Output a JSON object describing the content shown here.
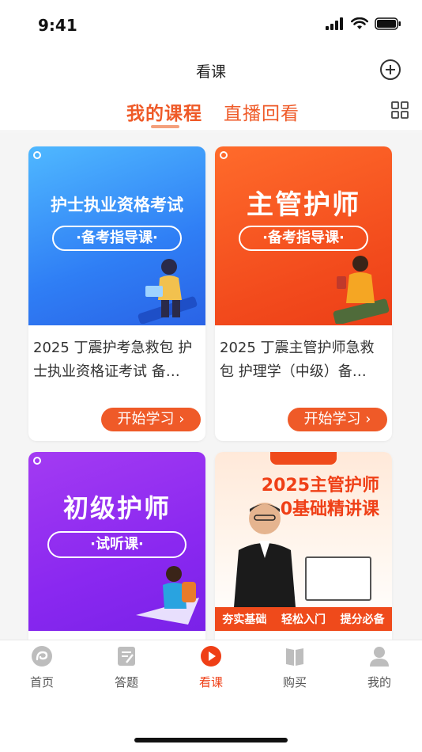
{
  "status_bar": {
    "time": "9:41"
  },
  "header": {
    "title": "看课"
  },
  "tabs": [
    {
      "label": "我的课程",
      "active": true
    },
    {
      "label": "直播回看",
      "active": false
    }
  ],
  "courses": [
    {
      "cover_title": "护士执业资格考试",
      "cover_pill": "·备考指导课·",
      "description": "2025 丁震护考急救包 护士执业资格证考试 备…",
      "button": "开始学习 ›"
    },
    {
      "cover_title": "主管护师",
      "cover_pill": "·备考指导课·",
      "description": "2025 丁震主管护师急救包 护理学（中级）备…",
      "button": "开始学习 ›"
    },
    {
      "cover_title": "初级护师",
      "cover_pill": "·试听课·"
    },
    {
      "cover_title_line1": "2025主管护师",
      "cover_title_line2": "0基础精讲课",
      "strip": [
        "夯实基础",
        "轻松入门",
        "提分必备"
      ]
    }
  ],
  "tabbar": [
    {
      "label": "首页",
      "icon": "home-icon"
    },
    {
      "label": "答题",
      "icon": "answer-icon"
    },
    {
      "label": "看课",
      "icon": "play-icon",
      "active": true
    },
    {
      "label": "购买",
      "icon": "book-icon"
    },
    {
      "label": "我的",
      "icon": "profile-icon"
    }
  ],
  "colors": {
    "accent": "#ef5a28",
    "active_tab": "#ef3f16"
  }
}
